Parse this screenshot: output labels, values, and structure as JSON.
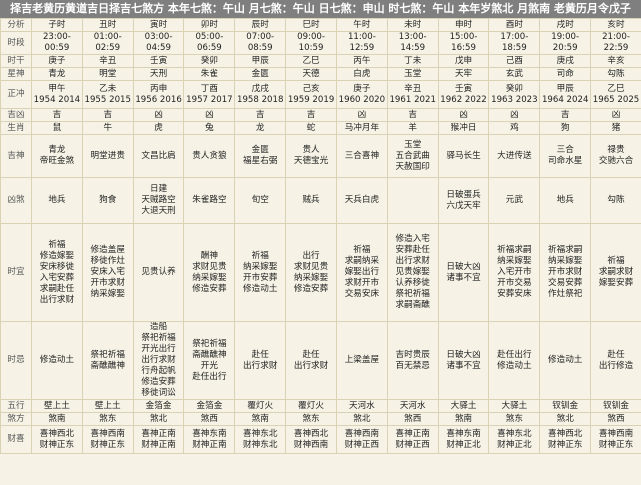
{
  "header": {
    "title": "择吉老黄历黄道吉日择吉七煞方 本年七煞：午山 月七煞：午山 日七煞：申山 时七煞：午山 本年岁煞北 月煞南 老黄历月令戊子"
  },
  "labels": {
    "fenxi": "分析",
    "shiduan": "时段",
    "shigan": "时干",
    "xingshen": "星神",
    "zhengchong": "正冲",
    "jixiong": "吉凶",
    "shengxiao": "生肖",
    "jishen": "吉神",
    "xiongsha": "凶煞",
    "shiyi": "时宜",
    "shiji": "时忌",
    "wuxing": "五行",
    "shafang": "煞方",
    "caishen": "财喜"
  },
  "columns": [
    {
      "name": "子时",
      "time": "23:00-00:59",
      "gan": "庚子",
      "star": "青龙",
      "chong": [
        "甲午",
        "1954 2014"
      ],
      "luck": "吉",
      "luck_color": "red",
      "zodiac": "鼠",
      "jishen": [
        "青龙",
        "帝旺金煞"
      ],
      "xiongsha": [
        "地兵"
      ],
      "yi": [
        "祈福",
        "修造嫁娶",
        "安床移徙",
        "入宅安葬",
        "求嗣赴任",
        "出行求财"
      ],
      "ji": [
        "修造动土"
      ],
      "wuxing": "壁上土",
      "sha": "煞南",
      "cai": [
        "喜神西北",
        "财神正东"
      ]
    },
    {
      "name": "丑时",
      "time": "01:00-02:59",
      "gan": "辛丑",
      "star": "明堂",
      "chong": [
        "乙未",
        "1955 2015"
      ],
      "luck": "吉",
      "luck_color": "red",
      "zodiac": "牛",
      "jishen": [
        "明堂进贵"
      ],
      "xiongsha": [
        "狗食"
      ],
      "yi": [
        "修造盖屋",
        "移徙作灶",
        "安床入宅",
        "开市求财",
        "纳采嫁娶"
      ],
      "ji": [
        "祭祀祈福",
        "斋醮醮神"
      ],
      "wuxing": "壁上土",
      "sha": "煞东",
      "cai": [
        "喜神西南",
        "财神正东"
      ]
    },
    {
      "name": "寅时",
      "time": "03:00-04:59",
      "gan": "壬寅",
      "star": "天刑",
      "chong": [
        "丙申",
        "1956 2016"
      ],
      "luck": "凶",
      "luck_color": "blue",
      "zodiac": "虎",
      "jishen": [
        "文昌比肩"
      ],
      "xiongsha": [
        "日建",
        "天贼路空",
        "大退天刑"
      ],
      "yi": [
        "见贵认养"
      ],
      "ji": [
        "造船",
        "祭祀祈福",
        "开光出行",
        "出行求财",
        "行舟起帆",
        "修造安葬",
        "移徙词讼"
      ],
      "wuxing": "金箔金",
      "sha": "煞北",
      "cai": [
        "喜神正南",
        "财神正南"
      ]
    },
    {
      "name": "卯时",
      "time": "05:00-06:59",
      "gan": "癸卯",
      "star": "朱雀",
      "chong": [
        "丁酉",
        "1957 2017"
      ],
      "luck": "凶",
      "luck_color": "blue",
      "zodiac": "兔",
      "jishen": [
        "贵人贪狼"
      ],
      "xiongsha": [
        "朱雀路空"
      ],
      "yi": [
        "酬神",
        "求财见贵",
        "纳采嫁娶",
        "修造安葬"
      ],
      "ji": [
        "祭祀祈福",
        "斋醮醮神",
        "开光",
        "赴任出行"
      ],
      "wuxing": "金箔金",
      "sha": "煞西",
      "cai": [
        "喜神东南",
        "财神正南"
      ]
    },
    {
      "name": "辰时",
      "time": "07:00-08:59",
      "gan": "甲辰",
      "star": "金匮",
      "chong": [
        "戊戌",
        "1958 2018"
      ],
      "luck": "吉",
      "luck_color": "red",
      "zodiac": "龙",
      "jishen": [
        "金匮",
        "福星右弼"
      ],
      "xiongsha": [
        "旬空"
      ],
      "yi": [
        "祈福",
        "纳采嫁娶",
        "开市安葬",
        "修造动土"
      ],
      "ji": [
        "赴任",
        "出行求财"
      ],
      "wuxing": "覆灯火",
      "sha": "煞南",
      "cai": [
        "喜神东北",
        "财神东北"
      ]
    },
    {
      "name": "巳时",
      "time": "09:00-10:59",
      "gan": "乙巳",
      "star": "天德",
      "chong": [
        "己亥",
        "1959 2019"
      ],
      "luck": "吉",
      "luck_color": "red",
      "zodiac": "蛇",
      "jishen": [
        "贵人",
        "天德宝光"
      ],
      "xiongsha": [
        "贼兵"
      ],
      "yi": [
        "出行",
        "求财见贵",
        "纳采嫁娶",
        "修造安葬"
      ],
      "ji": [
        "赴任",
        "出行求财"
      ],
      "wuxing": "覆灯火",
      "sha": "煞东",
      "cai": [
        "喜神西北",
        "财神西南"
      ]
    },
    {
      "name": "午时",
      "time": "11:00-12:59",
      "gan": "丙午",
      "star": "白虎",
      "chong": [
        "庚子",
        "1960 2020"
      ],
      "luck": "凶",
      "luck_color": "blue",
      "zodiac": "马冲月年",
      "jishen": [
        "三合喜神"
      ],
      "xiongsha": [
        "天兵白虎"
      ],
      "yi": [
        "祈福",
        "求嗣纳采",
        "嫁娶出行",
        "求财开市",
        "交易安床"
      ],
      "ji": [
        "上梁盖屋"
      ],
      "wuxing": "天河水",
      "sha": "煞北",
      "cai": [
        "喜神西南",
        "财神正西"
      ]
    },
    {
      "name": "未时",
      "time": "13:00-14:59",
      "gan": "丁未",
      "star": "玉堂",
      "chong": [
        "辛丑",
        "1961 2021"
      ],
      "luck": "吉",
      "luck_color": "red",
      "zodiac": "羊",
      "jishen": [
        "玉堂",
        "五合武曲",
        "天赦国印"
      ],
      "xiongsha": [],
      "yi": [
        "修造入宅",
        "安葬赴任",
        "出行求财",
        "见贵嫁娶",
        "认养移徙",
        "祭祀祈福",
        "求嗣斋醮"
      ],
      "ji": [
        "吉时贵辰",
        "百无禁忌"
      ],
      "wuxing": "天河水",
      "sha": "煞西",
      "cai": [
        "喜神正南",
        "财神正西"
      ]
    },
    {
      "name": "申时",
      "time": "15:00-16:59",
      "gan": "戊申",
      "star": "天牢",
      "chong": [
        "壬寅",
        "1962 2022"
      ],
      "luck": "凶",
      "luck_color": "blue",
      "zodiac": "猴冲日",
      "jishen": [
        "驿马长生"
      ],
      "xiongsha": [
        "日破蛋兵",
        "六戊天牢"
      ],
      "yi": [
        "日破大凶",
        "诸事不宜"
      ],
      "ji": [
        "日破大凶",
        "诸事不宜"
      ],
      "wuxing": "大驿土",
      "sha": "煞南",
      "cai": [
        "喜神东南",
        "财神正北"
      ]
    },
    {
      "name": "酉时",
      "time": "17:00-18:59",
      "gan": "己酉",
      "star": "玄武",
      "chong": [
        "癸卯",
        "1963 2023"
      ],
      "luck": "凶",
      "luck_color": "blue",
      "zodiac": "鸡",
      "jishen": [
        "大进传送"
      ],
      "xiongsha": [
        "元武"
      ],
      "yi": [
        "祈福求嗣",
        "纳采嫁娶",
        "入宅开市",
        "开市交易",
        "安葬安床"
      ],
      "ji": [
        "赴任出行",
        "修造动土"
      ],
      "wuxing": "大驿土",
      "sha": "煞东",
      "cai": [
        "喜神东北",
        "财神正北"
      ]
    },
    {
      "name": "戌时",
      "time": "19:00-20:59",
      "gan": "庚戌",
      "star": "司命",
      "chong": [
        "甲辰",
        "1964 2024"
      ],
      "luck": "吉",
      "luck_color": "red",
      "zodiac": "狗",
      "jishen": [
        "三合",
        "司命水星"
      ],
      "xiongsha": [
        "地兵"
      ],
      "yi": [
        "祈福求嗣",
        "纳采嫁娶",
        "开市求财",
        "交易安葬",
        "作灶祭祀"
      ],
      "ji": [
        "修造动土"
      ],
      "wuxing": "钗钏金",
      "sha": "煞北",
      "cai": [
        "喜神西北",
        "财神正东"
      ]
    },
    {
      "name": "亥时",
      "time": "21:00-22:59",
      "gan": "辛亥",
      "star": "勾陈",
      "chong": [
        "乙巳",
        "1965 2025"
      ],
      "luck": "凶",
      "luck_color": "blue",
      "zodiac": "猪",
      "jishen": [
        "禄贵",
        "交驰六合"
      ],
      "xiongsha": [
        "勾陈"
      ],
      "yi": [
        "祈福",
        "求嗣求财",
        "嫁娶安葬"
      ],
      "ji": [
        "赴任",
        "出行修造"
      ],
      "wuxing": "钗钏金",
      "sha": "煞西",
      "cai": [
        "喜神西南",
        "财神正东"
      ]
    }
  ]
}
